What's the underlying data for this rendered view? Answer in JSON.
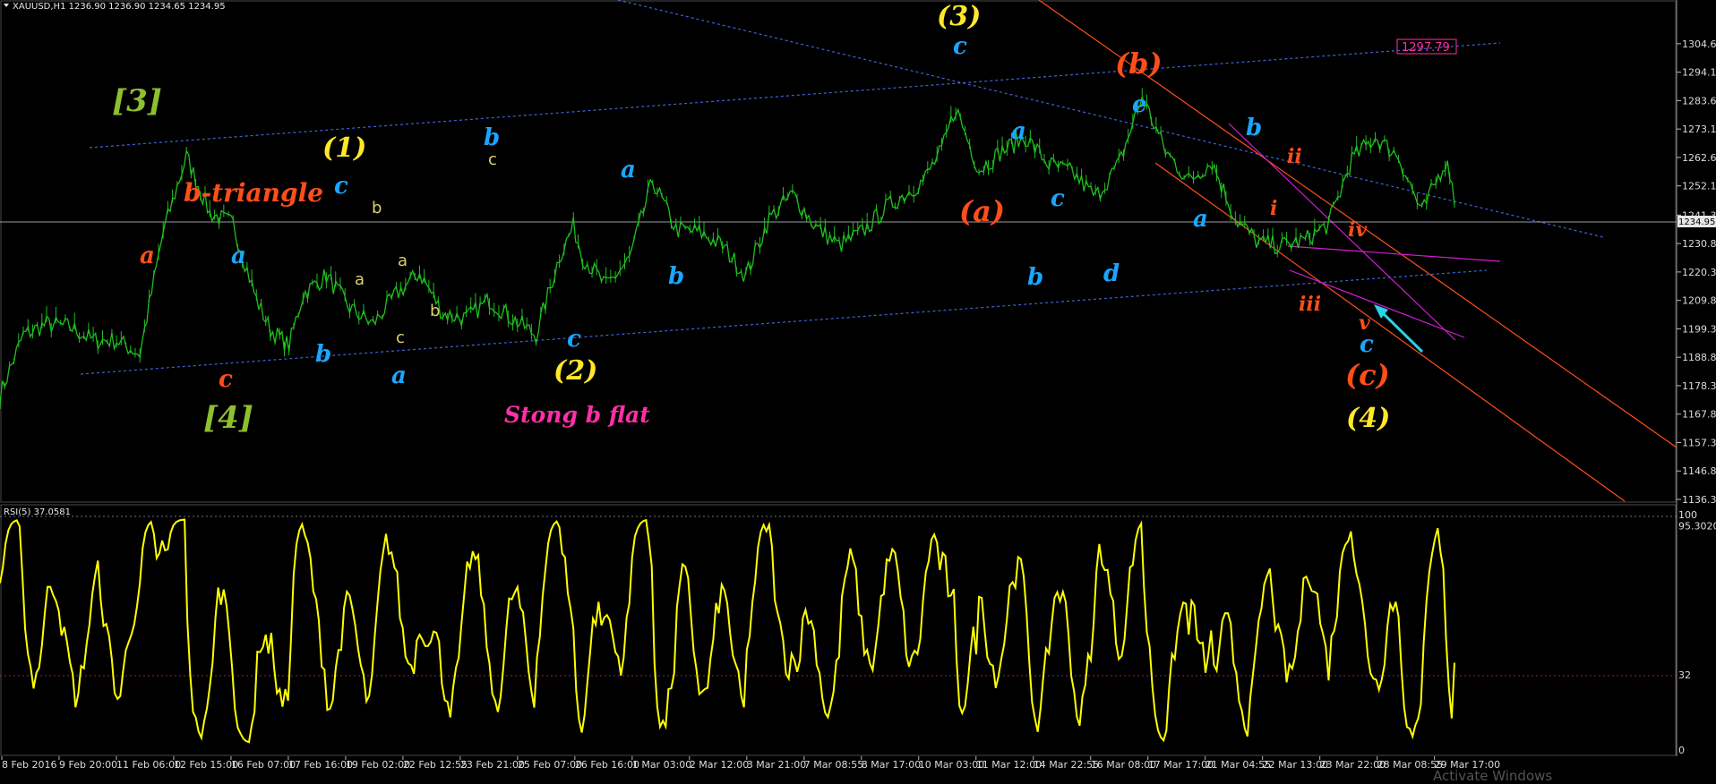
{
  "window": {
    "symbol_header": "XAUUSD,H1  1236.90 1236.90 1234.65 1234.95",
    "rsi_header": "RSI(5) 37.0581",
    "watermark": "Activate Windows"
  },
  "colors": {
    "background": "#000000",
    "candles": "#1fbf1f",
    "rsi_line": "#ffff00",
    "blue_label": "#1aa6ff",
    "orange_label": "#ff4e1a",
    "yellow_label": "#ffe82a",
    "olive_label": "#8fbf2f",
    "pink_label": "#ff2fa6",
    "channel_dotted": "#3f63d9",
    "orange_channel": "#ff4e1a",
    "magenta_lines": "#d11ed1",
    "arrow": "#2ad3e6"
  },
  "chart_data": [
    {
      "type": "line",
      "name": "XAUUSD,H1",
      "ylim": [
        1136.3,
        1311.5
      ],
      "yticks": [
        "1304.60",
        "1294.10",
        "1283.60",
        "1273.10",
        "1262.60",
        "1252.10",
        "1241.30",
        "1230.80",
        "1220.30",
        "1209.80",
        "1199.30",
        "1188.80",
        "1178.30",
        "1167.80",
        "1157.30",
        "1146.80",
        "1136.30"
      ],
      "current_price": "1234.95",
      "price_box": "1297.79",
      "xticks": [
        "8 Feb 2016",
        "9 Feb 20:00",
        "11 Feb 06:00",
        "12 Feb 15:00",
        "16 Feb 07:00",
        "17 Feb 16:00",
        "19 Feb 02:00",
        "22 Feb 12:55",
        "23 Feb 21:00",
        "25 Feb 07:00",
        "26 Feb 16:00",
        "1 Mar 03:00",
        "2 Mar 12:00",
        "3 Mar 21:00",
        "7 Mar 08:55",
        "8 Mar 17:00",
        "10 Mar 03:00",
        "11 Mar 12:00",
        "14 Mar 22:55",
        "16 Mar 08:00",
        "17 Mar 17:00",
        "21 Mar 04:55",
        "22 Mar 13:00",
        "23 Mar 22:00",
        "28 Mar 08:55",
        "29 Mar 17:00"
      ],
      "x": [
        0,
        5,
        10,
        15,
        20,
        25,
        30,
        35,
        40,
        45,
        50,
        55,
        58,
        62,
        65,
        70,
        75,
        80,
        85,
        90,
        95,
        100,
        105,
        110,
        115,
        120,
        123,
        125,
        130,
        135,
        140,
        145,
        150,
        155,
        160,
        165,
        170,
        175,
        180,
        185,
        190,
        195,
        198,
        202,
        205,
        210,
        215,
        220,
        225,
        230,
        235,
        240,
        245,
        250,
        255,
        260,
        265,
        270,
        275,
        280,
        285,
        290,
        295,
        300,
        305,
        310,
        312
      ],
      "price": [
        1175,
        1197,
        1201,
        1200,
        1195,
        1195,
        1190,
        1235,
        1263,
        1242,
        1238,
        1210,
        1199,
        1193,
        1212,
        1219,
        1207,
        1201,
        1212,
        1220,
        1205,
        1203,
        1210,
        1203,
        1197,
        1226,
        1237,
        1226,
        1215,
        1225,
        1254,
        1236,
        1235,
        1230,
        1219,
        1240,
        1249,
        1237,
        1230,
        1235,
        1244,
        1250,
        1254,
        1265,
        1281,
        1258,
        1265,
        1270,
        1260,
        1257,
        1248,
        1260,
        1285,
        1265,
        1254,
        1261,
        1240,
        1231,
        1230,
        1232,
        1238,
        1262,
        1270,
        1263,
        1242,
        1261,
        1253,
        1245
      ],
      "wave_labels": {
        "wave_3_bracket": "[3]",
        "wave_4_bracket": "[4]",
        "wave_1": "(1)",
        "wave_2": "(2)",
        "wave_3": "(3)",
        "wave_4": "(4)",
        "wave_a_paren": "(a)",
        "wave_b_paren": "(b)",
        "wave_c_paren": "(c)",
        "b_triangle": "b-triangle",
        "strong_b_flat": "Stong b flat",
        "a": "a",
        "b": "b",
        "c": "c",
        "d": "d",
        "e": "e",
        "i": "i",
        "ii": "ii",
        "iii": "iii",
        "iv": "iv",
        "v": "v"
      }
    },
    {
      "type": "line",
      "name": "RSI(5) 37.0581",
      "ylim": [
        0,
        100
      ],
      "yticks": [
        "100",
        "95.3020",
        "32",
        "0"
      ],
      "levels": [
        95.302,
        32
      ],
      "current_value": 37.0581
    }
  ]
}
